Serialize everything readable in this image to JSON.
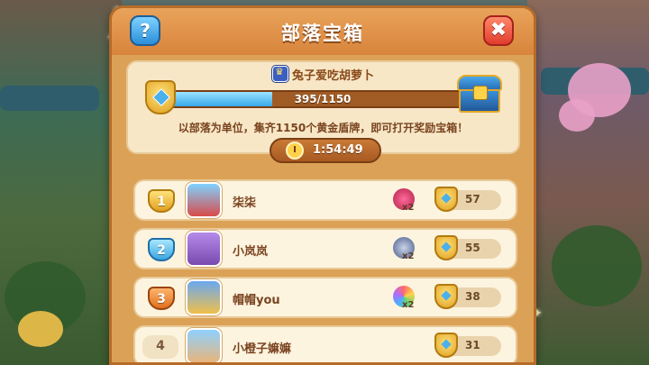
{
  "header": {
    "title": "部落宝箱",
    "help_label": "?",
    "close_label": "✖"
  },
  "progress": {
    "tribe_name": "兔子爱吃胡萝卜",
    "current": 395,
    "goal": 1150,
    "text": "395/1150",
    "description": "以部落为单位，集齐1150个黄金盾牌，即可打开奖励宝箱！"
  },
  "timer": {
    "value": "1:54:49"
  },
  "leaderboard": [
    {
      "rank": "1",
      "name": "柒柒",
      "reward_icon": "heart-gem-icon",
      "reward_count": "x2",
      "shields": "57",
      "avatar_color": "#d94b4b"
    },
    {
      "rank": "2",
      "name": "小岚岚",
      "reward_icon": "bell-bomb-icon",
      "reward_count": "x2",
      "shields": "55",
      "avatar_color": "#8a5ad0"
    },
    {
      "rank": "3",
      "name": "帽帽you",
      "reward_icon": "rainbow-orb-icon",
      "reward_count": "x2",
      "shields": "38",
      "avatar_color": "#3f6fd0"
    },
    {
      "rank": "4",
      "name": "小橙子嫲嫲",
      "reward_icon": "",
      "reward_count": "",
      "shields": "31",
      "avatar_color": "#4aa0d8"
    }
  ],
  "colors": {
    "panel": "#dba257",
    "accent_blue": "#38a8e8",
    "gold": "#e0a020"
  }
}
